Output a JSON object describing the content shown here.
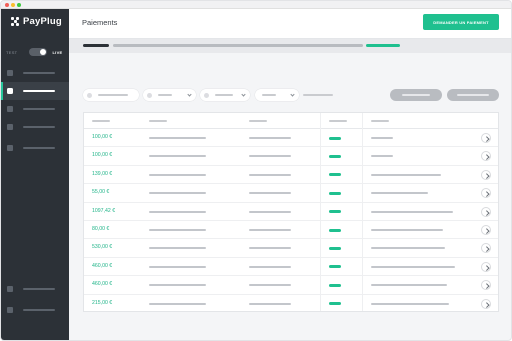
{
  "app": {
    "brand": "PayPlug",
    "colors": {
      "accent": "#1fc08f",
      "sidebar": "#2c3137",
      "amount": "#1fb488"
    }
  },
  "sidebar": {
    "mode": {
      "test_label": "TEST",
      "live_label": "LIVE",
      "live_enabled": true
    },
    "items": [
      {
        "icon": "nav-icon",
        "active": false
      },
      {
        "icon": "nav-icon",
        "active": true
      },
      {
        "icon": "nav-icon",
        "active": false
      },
      {
        "icon": "nav-icon",
        "active": false
      },
      {
        "icon": "nav-icon",
        "active": false
      }
    ],
    "bottom_items": [
      {
        "icon": "nav-icon"
      },
      {
        "icon": "nav-icon"
      }
    ]
  },
  "header": {
    "title": "Paiements",
    "cta_label": "DEMANDER UN PAIEMENT"
  },
  "payments": {
    "amounts": [
      "100,00 €",
      "100,00 €",
      "139,00 €",
      "55,00 €",
      "1097,42 €",
      "80,00 €",
      "530,00 €",
      "460,00 €",
      "460,00 €",
      "215,00 €"
    ]
  }
}
